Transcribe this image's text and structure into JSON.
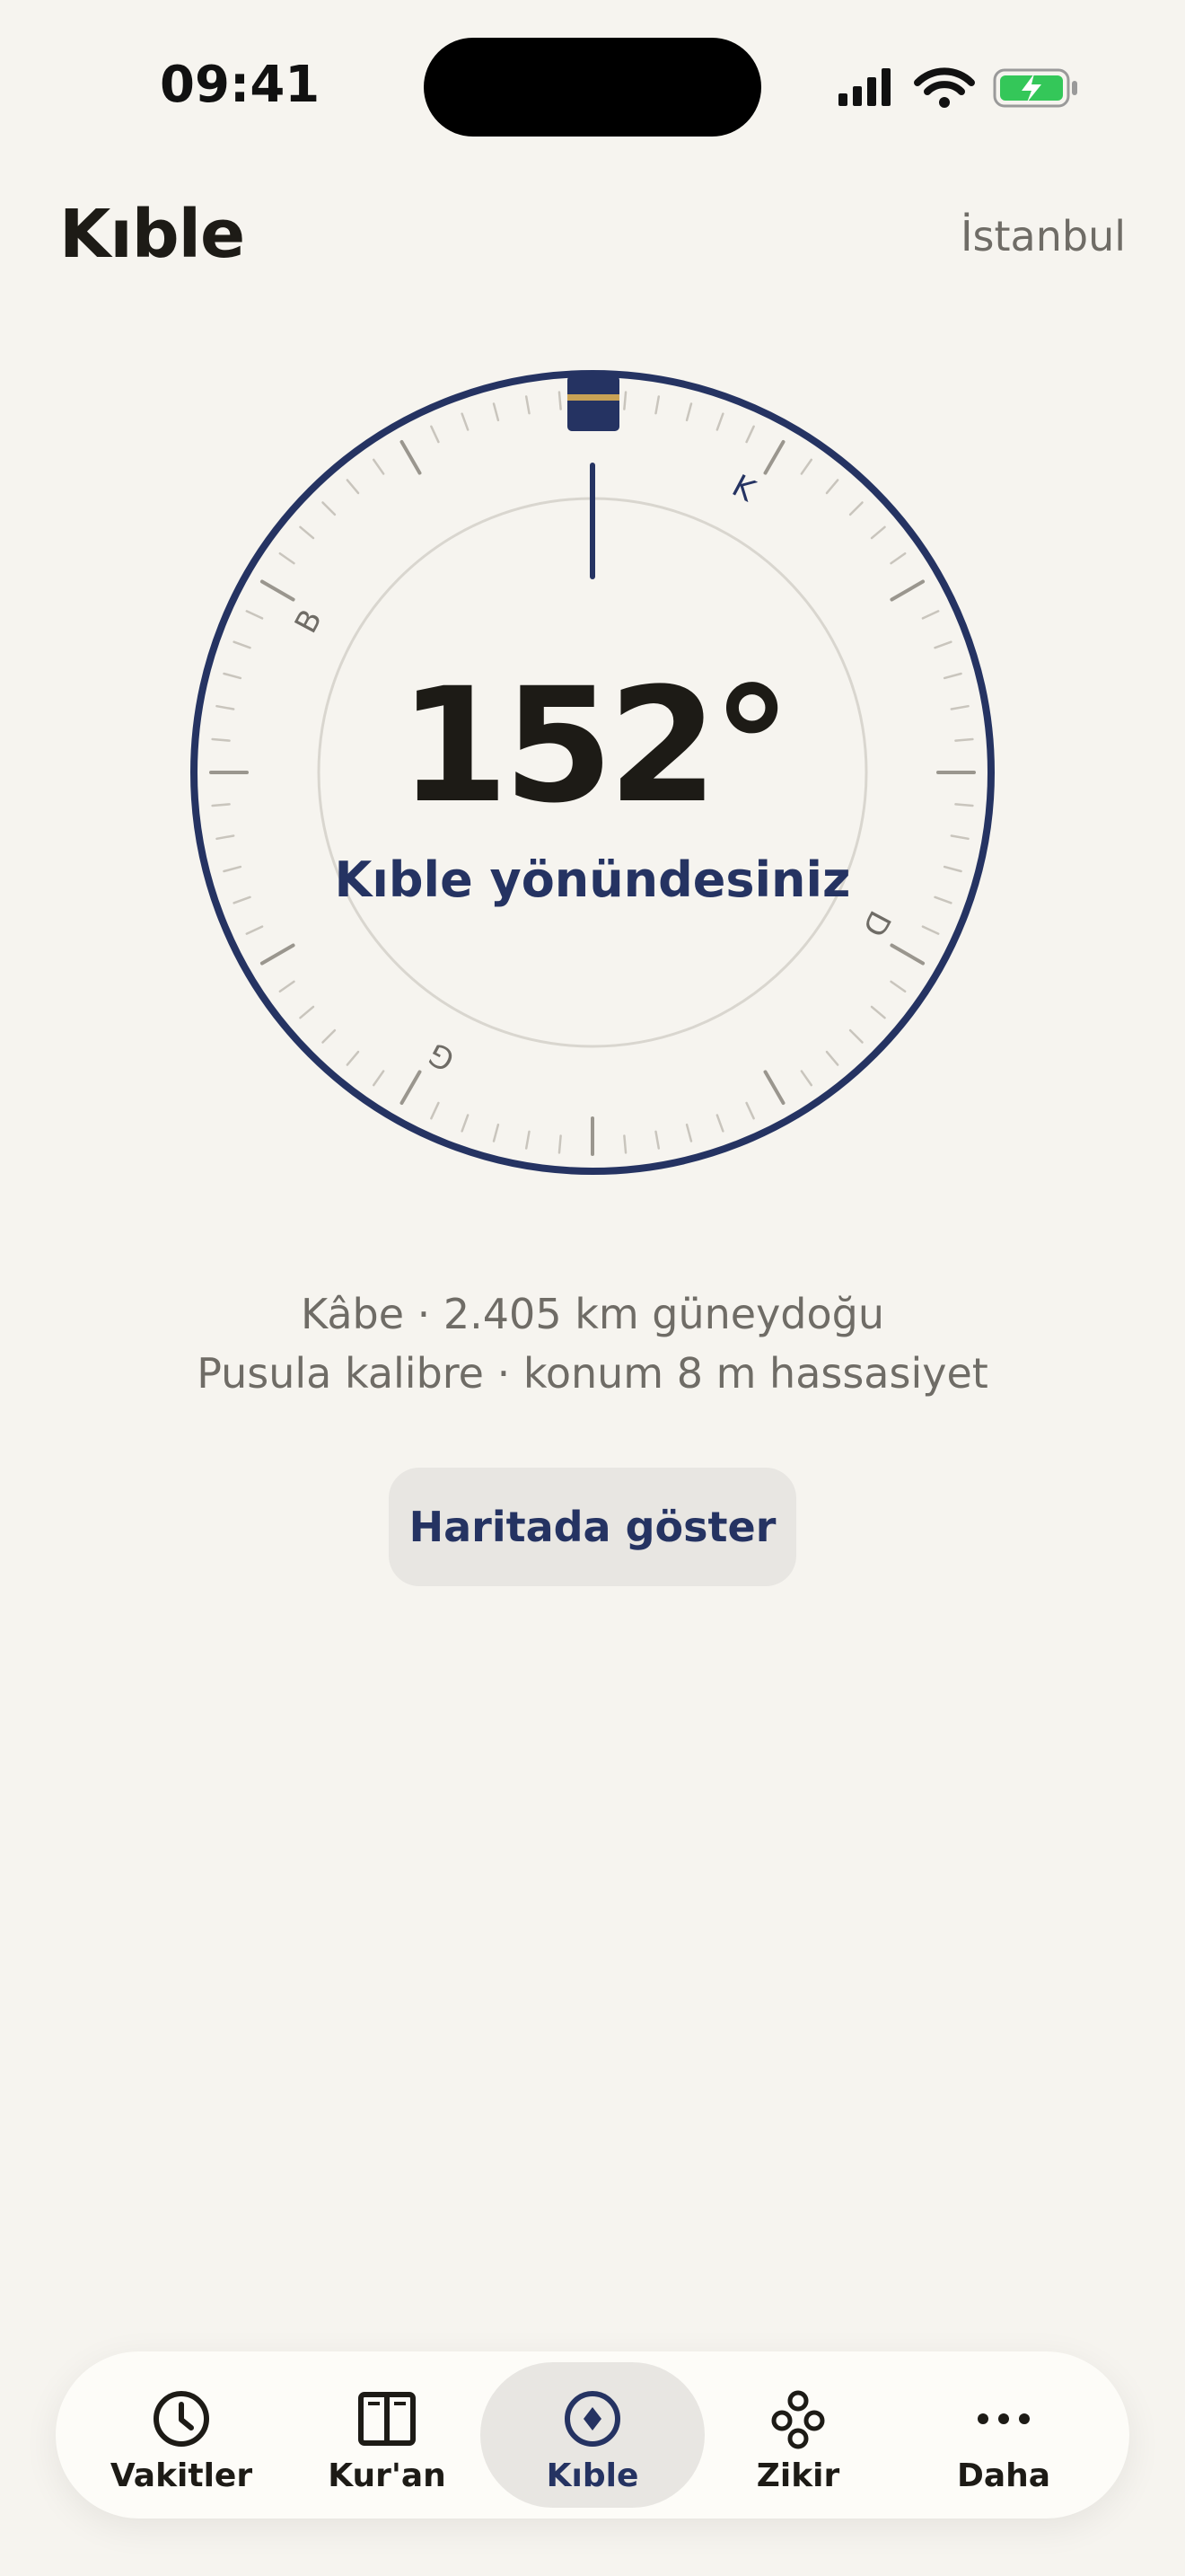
{
  "status_bar": {
    "time": "09:41"
  },
  "header": {
    "title": "Kıble",
    "city": "İstanbul"
  },
  "compass": {
    "heading_degrees": 152,
    "degree_text": "152°",
    "message": "Kıble yönündesiniz",
    "cardinal_labels": [
      "K",
      "D",
      "G",
      "B"
    ],
    "ring_color": "#253362",
    "kaaba_color": "#253362",
    "kaaba_band_color": "#c9a255"
  },
  "info": {
    "line1": "Kâbe · 2.405 km güneydoğu",
    "line2": "Pusula kalibre · konum 8 m hassasiyet"
  },
  "map_button": {
    "label": "Haritada göster"
  },
  "tabbar": {
    "items": [
      {
        "label": "Vakitler",
        "icon": "clock-icon"
      },
      {
        "label": "Kur'an",
        "icon": "book-icon"
      },
      {
        "label": "Kıble",
        "icon": "compass-icon",
        "active": true
      },
      {
        "label": "Zikir",
        "icon": "beads-icon"
      },
      {
        "label": "Daha",
        "icon": "more-icon"
      }
    ]
  }
}
